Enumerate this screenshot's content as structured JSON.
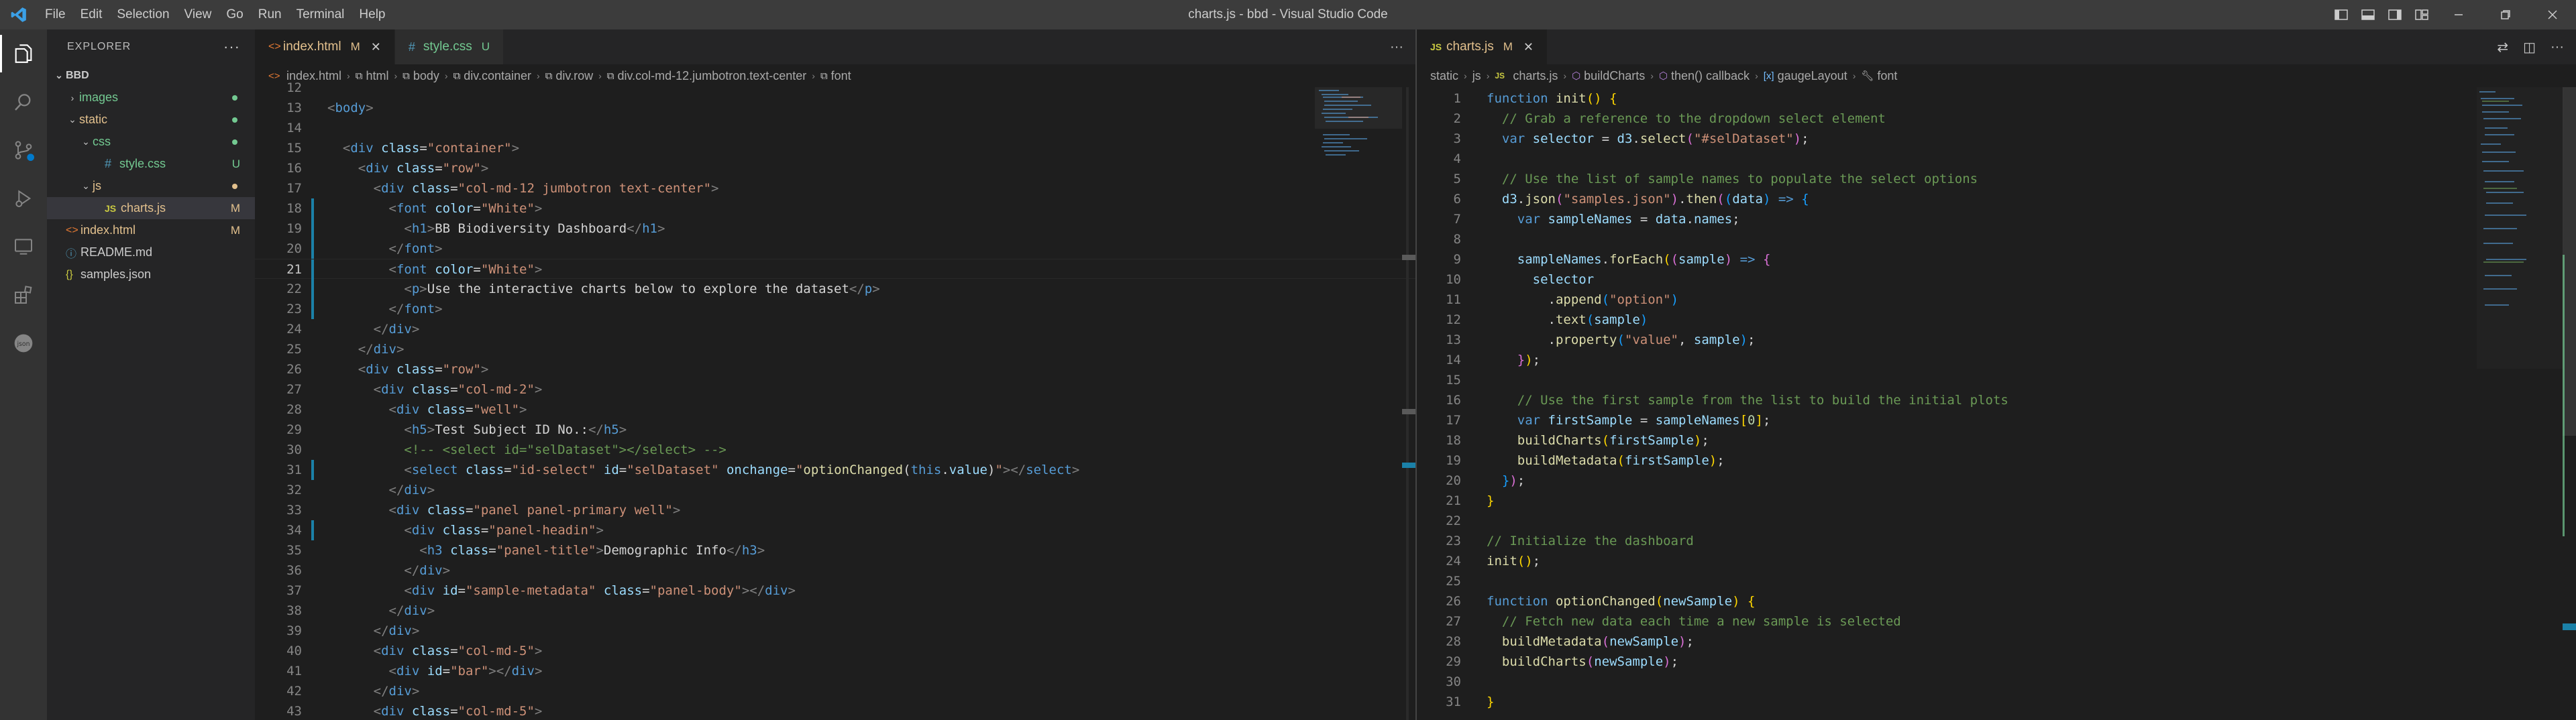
{
  "titlebar": {
    "menu": [
      "File",
      "Edit",
      "Selection",
      "View",
      "Go",
      "Run",
      "Terminal",
      "Help"
    ],
    "title": "charts.js - bbd - Visual Studio Code"
  },
  "sidebar": {
    "header": "EXPLORER",
    "root": "BBD",
    "items": [
      {
        "label": "images",
        "type": "folder"
      },
      {
        "label": "static",
        "type": "folder"
      },
      {
        "label": "css",
        "type": "folder"
      },
      {
        "label": "style.css",
        "type": "css",
        "badge": "U"
      },
      {
        "label": "js",
        "type": "folder"
      },
      {
        "label": "charts.js",
        "type": "js",
        "badge": "M"
      },
      {
        "label": "index.html",
        "type": "html",
        "badge": "M"
      },
      {
        "label": "README.md",
        "type": "info"
      },
      {
        "label": "samples.json",
        "type": "json"
      }
    ]
  },
  "left_editor": {
    "tabs": [
      {
        "label": "index.html",
        "status": "M"
      },
      {
        "label": "style.css",
        "status": "U"
      }
    ],
    "breadcrumb": [
      "index.html",
      "html",
      "body",
      "div.container",
      "div.row",
      "div.col-md-12.jumbotron.text-center",
      "font"
    ],
    "line_numbers": [
      "12",
      "13",
      "14",
      "15",
      "16",
      "17",
      "18",
      "19",
      "20",
      "21",
      "22",
      "23",
      "24",
      "25",
      "26",
      "27",
      "28",
      "29",
      "30",
      "31",
      "32",
      "33",
      "34",
      "35",
      "36",
      "37",
      "38",
      "39",
      "40",
      "41",
      "42",
      "43"
    ],
    "current_line": "21"
  },
  "right_editor": {
    "tabs": [
      {
        "label": "charts.js",
        "status": "M"
      }
    ],
    "breadcrumb": [
      "static",
      "js",
      "charts.js",
      "buildCharts",
      "then() callback",
      "gaugeLayout",
      "font"
    ],
    "line_numbers": [
      "1",
      "2",
      "3",
      "4",
      "5",
      "6",
      "7",
      "8",
      "9",
      "10",
      "11",
      "12",
      "13",
      "14",
      "15",
      "16",
      "17",
      "18",
      "19",
      "20",
      "21",
      "22",
      "23",
      "24",
      "25",
      "26",
      "27",
      "28",
      "29",
      "30",
      "31"
    ]
  },
  "colors": {
    "accent": "#007acc",
    "modified": "#e2c08d",
    "untracked": "#73c991",
    "editor_bg": "#1e1e1e"
  }
}
